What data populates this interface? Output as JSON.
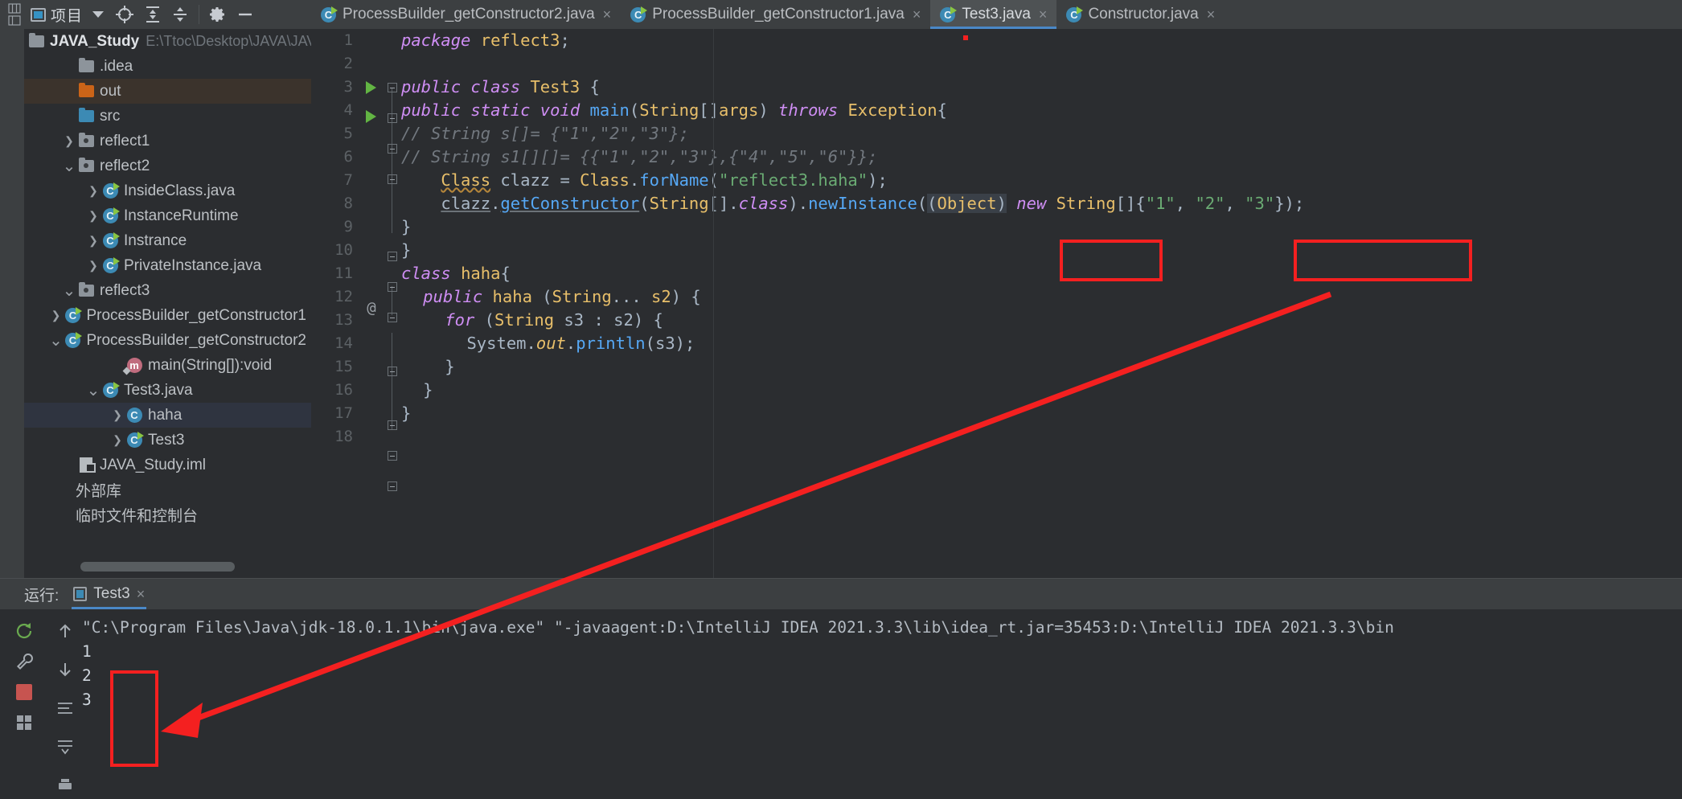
{
  "window": {
    "toolbar": {
      "project_label": "项目",
      "icons": [
        "project-toggle-icon",
        "dropdown-caret-icon",
        "locate-icon",
        "expand-all-icon",
        "collapse-all-icon",
        "settings-gear-icon",
        "hide-icon"
      ]
    },
    "tabs": [
      {
        "label": "ProcessBuilder_getConstructor2.java",
        "active": false,
        "close": "×"
      },
      {
        "label": "ProcessBuilder_getConstructor1.java",
        "active": false,
        "close": "×"
      },
      {
        "label": "Test3.java",
        "active": true,
        "close": "×"
      },
      {
        "label": "Constructor.java",
        "active": false,
        "close": "×"
      }
    ]
  },
  "project": {
    "name": "JAVA_Study",
    "path": "E:\\Ttoc\\Desktop\\JAVA\\JAVA_S",
    "tree": [
      {
        "label": ".idea",
        "indent": 1,
        "arrow": "none",
        "icon": "folder-grey",
        "sel": ""
      },
      {
        "label": "out",
        "indent": 1,
        "arrow": "none",
        "icon": "folder-orange",
        "sel": "brown"
      },
      {
        "label": "src",
        "indent": 1,
        "arrow": "none",
        "icon": "folder-blue",
        "sel": ""
      },
      {
        "label": "reflect1",
        "indent": 1,
        "arrow": "right",
        "icon": "folder-package",
        "sel": ""
      },
      {
        "label": "reflect2",
        "indent": 1,
        "arrow": "down",
        "icon": "folder-package",
        "sel": ""
      },
      {
        "label": "InsideClass.java",
        "indent": 2,
        "arrow": "right",
        "icon": "java-class",
        "sel": ""
      },
      {
        "label": "InstanceRuntime",
        "indent": 2,
        "arrow": "right",
        "icon": "java-class",
        "sel": ""
      },
      {
        "label": "Instrance",
        "indent": 2,
        "arrow": "right",
        "icon": "java-class",
        "sel": ""
      },
      {
        "label": "PrivateInstance.java",
        "indent": 2,
        "arrow": "right",
        "icon": "java-class",
        "sel": ""
      },
      {
        "label": "reflect3",
        "indent": 1,
        "arrow": "down",
        "icon": "folder-package",
        "sel": ""
      },
      {
        "label": "ProcessBuilder_getConstructor1",
        "indent": 2,
        "arrow": "right",
        "icon": "java-class",
        "sel": ""
      },
      {
        "label": "ProcessBuilder_getConstructor2",
        "indent": 2,
        "arrow": "down",
        "icon": "java-class",
        "sel": ""
      },
      {
        "label": "main(String[]):void",
        "indent": 3,
        "arrow": "none",
        "icon": "method",
        "sel": ""
      },
      {
        "label": "Test3.java",
        "indent": 2,
        "arrow": "down",
        "icon": "java-class",
        "sel": ""
      },
      {
        "label": "haha",
        "indent": 3,
        "arrow": "right",
        "icon": "java-class-plain",
        "sel": "blue"
      },
      {
        "label": "Test3",
        "indent": 3,
        "arrow": "right",
        "icon": "java-class",
        "sel": ""
      },
      {
        "label": "JAVA_Study.iml",
        "indent": 1,
        "arrow": "none",
        "icon": "iml",
        "sel": ""
      },
      {
        "label": "外部库",
        "indent": 0,
        "arrow": "none",
        "icon": "none",
        "sel": ""
      },
      {
        "label": "临时文件和控制台",
        "indent": 0,
        "arrow": "none",
        "icon": "none",
        "sel": ""
      }
    ]
  },
  "editor": {
    "file": "Test3.java",
    "line_numbers": [
      1,
      2,
      3,
      4,
      5,
      6,
      7,
      8,
      9,
      10,
      11,
      12,
      13,
      14,
      15,
      16,
      17,
      18
    ],
    "lines": [
      {
        "n": 1,
        "text": "package reflect3;"
      },
      {
        "n": 2,
        "text": ""
      },
      {
        "n": 3,
        "text": "public class Test3 {"
      },
      {
        "n": 4,
        "text": "public static void main(String[]args) throws Exception{"
      },
      {
        "n": 5,
        "text": "//        String s[]= {\"1\",\"2\",\"3\"};"
      },
      {
        "n": 6,
        "text": "//        String s1[][]= {{\"1\",\"2\",\"3\"},{\"4\",\"5\",\"6\"}};"
      },
      {
        "n": 7,
        "text": "Class clazz = Class.forName(\"reflect3.haha\");"
      },
      {
        "n": 8,
        "text": "clazz.getConstructor(String[].class).newInstance((Object) new String[]{\"1\", \"2\", \"3\"});"
      },
      {
        "n": 9,
        "text": "}"
      },
      {
        "n": 10,
        "text": "}"
      },
      {
        "n": 11,
        "text": "class haha{"
      },
      {
        "n": 12,
        "text": "public haha (String... s2) {"
      },
      {
        "n": 13,
        "text": "for (String s3 : s2) {"
      },
      {
        "n": 14,
        "text": "System.out.println(s3);"
      },
      {
        "n": 15,
        "text": "}"
      },
      {
        "n": 16,
        "text": "}"
      },
      {
        "n": 17,
        "text": "}"
      },
      {
        "n": 18,
        "text": ""
      }
    ],
    "annotation_marker": "@",
    "highlight_boxes": [
      "(Object)",
      "{\"1\", \"2\", \"3\"}"
    ]
  },
  "run_panel": {
    "title": "运行:",
    "tab_label": "Test3",
    "tab_close": "×",
    "toolbar_icons": [
      "rerun-icon",
      "up-arrow-icon",
      "wrench-icon",
      "down-arrow-icon",
      "stop-icon",
      "soft-wrap-icon",
      "scroll-to-end-icon",
      "print-icon"
    ],
    "command_line": "\"C:\\Program Files\\Java\\jdk-18.0.1.1\\bin\\java.exe\" \"-javaagent:D:\\IntelliJ IDEA 2021.3.3\\lib\\idea_rt.jar=35453:D:\\IntelliJ IDEA 2021.3.3\\bin",
    "output": [
      "1",
      "2",
      "3"
    ]
  },
  "colors": {
    "accent": "#4a88c7",
    "annotation_red": "#f42020",
    "selection_brown": "#3b332c",
    "keyword_purple": "#cf8ef4",
    "string_green": "#6aab73",
    "type_gold": "#e8bf6a",
    "method_blue": "#56a8f5"
  }
}
